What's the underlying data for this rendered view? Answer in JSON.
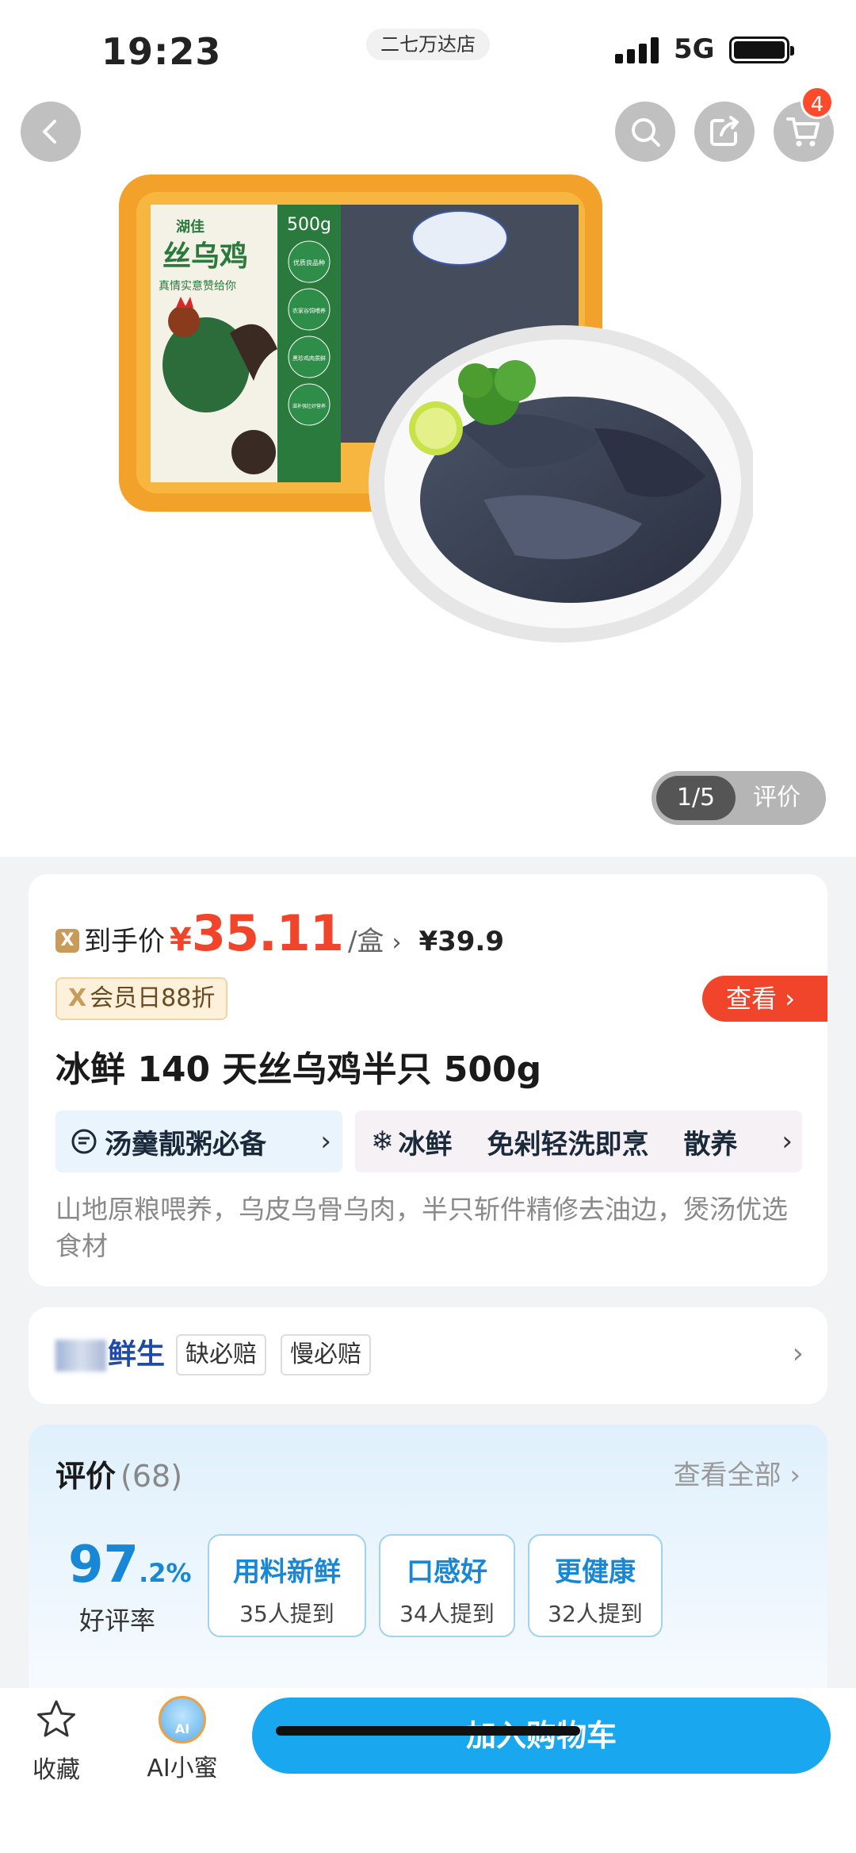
{
  "status_bar": {
    "time": "19:23",
    "network": "5G",
    "store": "二七万达店"
  },
  "header": {
    "cart_count": "4"
  },
  "product_photo": {
    "package_brand": "湖佳",
    "package_name": "丝乌鸡",
    "package_slogan": "真情实意赞给你",
    "package_weight": "500g",
    "package_features": [
      "优质良品种",
      "农家谷饲喂养",
      "黑珍鸡肉质鲜",
      "滋补强壮好营养"
    ]
  },
  "pager": {
    "current": "1/5",
    "label": "评价"
  },
  "price": {
    "prefix": "到手价",
    "currency": "¥",
    "value": "35.11",
    "unit": "/盒",
    "original": "¥39.9",
    "member_tag": "会员日88折",
    "view_label": "查看"
  },
  "product": {
    "title": "冰鲜 140 天丝乌鸡半只 500g",
    "tag_primary": "汤羹靓粥必备",
    "tags_secondary": [
      "冰鲜",
      "免剁轻洗即烹",
      "散养"
    ],
    "description": "山地原粮喂养，乌皮乌骨乌肉，半只斩件精修去油边，煲汤优选食材"
  },
  "shop": {
    "name": "鲜生",
    "badges": [
      "缺必赔",
      "慢必赔"
    ]
  },
  "reviews": {
    "title": "评价",
    "count": "(68)",
    "view_all": "查看全部",
    "rate_int": "97",
    "rate_dec": ".2%",
    "rate_label": "好评率",
    "keywords": [
      {
        "word": "用料新鲜",
        "count": "35人提到"
      },
      {
        "word": "口感好",
        "count": "34人提到"
      },
      {
        "word": "更健康",
        "count": "32人提到"
      }
    ]
  },
  "bottom_bar": {
    "favorite": "收藏",
    "ai": "AI小蜜",
    "ai_badge": "AI",
    "add_to_cart": "加入购物车"
  },
  "colors": {
    "price": "#f0442b",
    "primary": "#19a8f0",
    "rate": "#1787d6"
  }
}
